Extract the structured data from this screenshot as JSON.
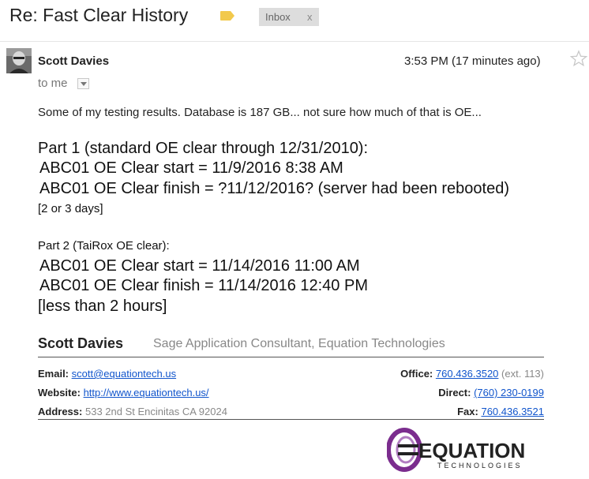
{
  "header": {
    "subject": "Re: Fast Clear History",
    "label": "Inbox",
    "label_close": "x"
  },
  "message": {
    "sender": "Scott Davies",
    "time": "3:53 PM (17 minutes ago)",
    "to": "to me",
    "intro": "Some of my testing results. Database is 187 GB... not sure how much of that is OE...",
    "part1": {
      "heading": "Part 1 (standard OE clear through 12/31/2010):",
      "line1": "ABC01  OE Clear start = 11/9/2016 8:38 AM",
      "line2": "ABC01  OE Clear finish = ?11/12/2016? (server had been rebooted)",
      "note": "[2 or 3 days]"
    },
    "part2": {
      "heading": "Part 2 (TaiRox OE clear):",
      "line1": "ABC01  OE Clear start = 11/14/2016 11:00 AM",
      "line2": "ABC01  OE Clear finish = 11/14/2016 12:40 PM",
      "note": "[less than 2 hours]"
    }
  },
  "signature": {
    "name": "Scott Davies",
    "title": "Sage Application Consultant, Equation Technologies",
    "email_label": "Email:",
    "email": "scott@equationtech.us",
    "website_label": "Website:",
    "website": "http://www.equationtech.us/",
    "address_label": "Address:",
    "address": "533 2nd St Encinitas CA 92024",
    "office_label": "Office:",
    "office": "760.436.3520",
    "office_ext": "(ext. 113)",
    "direct_label": "Direct:",
    "direct": "(760) 230-0199",
    "fax_label": "Fax:",
    "fax": "760.436.3521",
    "logo_text": "EQUATION",
    "logo_subtext": "TECHNOLOGIES"
  },
  "colors": {
    "link": "#1155cc",
    "label_tag": "#f2c94c",
    "logo_purple": "#7b2d8e"
  }
}
